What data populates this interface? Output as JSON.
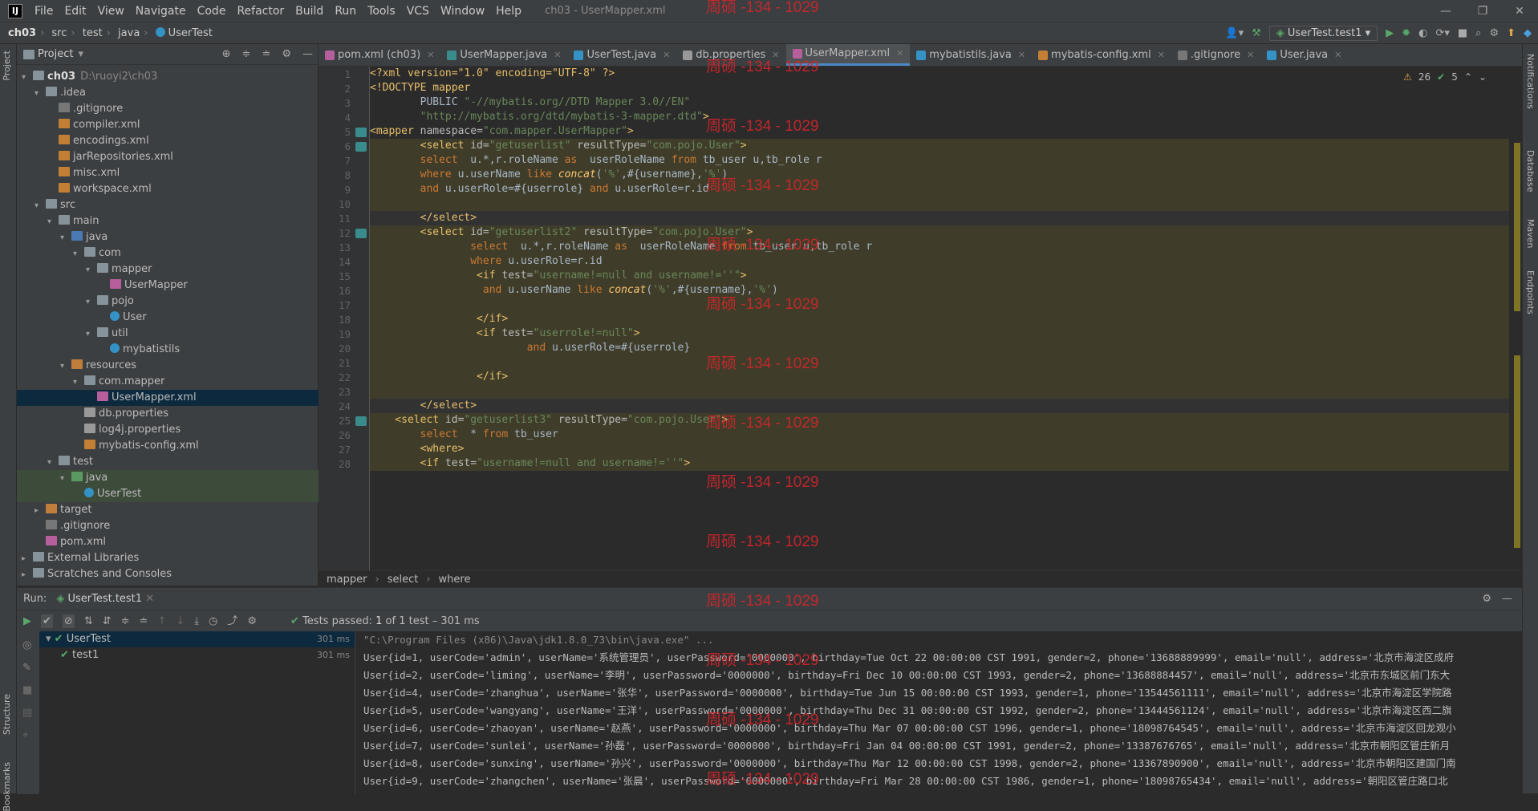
{
  "window": {
    "logo": "IJ",
    "menu": [
      "File",
      "Edit",
      "View",
      "Navigate",
      "Code",
      "Refactor",
      "Build",
      "Run",
      "Tools",
      "VCS",
      "Window",
      "Help"
    ],
    "title": "ch03 - UserMapper.xml",
    "buttons": [
      "—",
      "❐",
      "✕"
    ]
  },
  "nav": {
    "crumbs": [
      "ch03",
      "src",
      "test",
      "java",
      "UserTest"
    ],
    "run_config": "UserTest.test1"
  },
  "watermark": "周硕 -134 - 1029",
  "left_strip": {
    "project": "Project",
    "structure": "Structure",
    "bookmarks": "Bookmarks"
  },
  "right_strip": {
    "notifications": "Notifications",
    "database": "Database",
    "maven": "Maven",
    "endpoints": "Endpoints"
  },
  "project": {
    "title": "Project",
    "tree": [
      {
        "label": "ch03",
        "extra": "D:\\ruoyi2\\ch03",
        "depth": 0,
        "arrow": "v",
        "icon": "folder"
      },
      {
        "label": ".idea",
        "depth": 1,
        "arrow": "v",
        "icon": "folder"
      },
      {
        "label": ".gitignore",
        "depth": 2,
        "icon": "fileg"
      },
      {
        "label": "compiler.xml",
        "depth": 2,
        "icon": "filex"
      },
      {
        "label": "encodings.xml",
        "depth": 2,
        "icon": "filex"
      },
      {
        "label": "jarRepositories.xml",
        "depth": 2,
        "icon": "filex"
      },
      {
        "label": "misc.xml",
        "depth": 2,
        "icon": "filex"
      },
      {
        "label": "workspace.xml",
        "depth": 2,
        "icon": "filex"
      },
      {
        "label": "src",
        "depth": 1,
        "arrow": "v",
        "icon": "folder"
      },
      {
        "label": "main",
        "depth": 2,
        "arrow": "v",
        "icon": "folder"
      },
      {
        "label": "java",
        "depth": 3,
        "arrow": "v",
        "icon": "folder blue"
      },
      {
        "label": "com",
        "depth": 4,
        "arrow": "v",
        "icon": "folder"
      },
      {
        "label": "mapper",
        "depth": 5,
        "arrow": "v",
        "icon": "folder"
      },
      {
        "label": "UserMapper",
        "depth": 6,
        "icon": "filem"
      },
      {
        "label": "pojo",
        "depth": 5,
        "arrow": "v",
        "icon": "folder"
      },
      {
        "label": "User",
        "depth": 6,
        "icon": "filec"
      },
      {
        "label": "util",
        "depth": 5,
        "arrow": "v",
        "icon": "folder"
      },
      {
        "label": "mybatistils",
        "depth": 6,
        "icon": "filec"
      },
      {
        "label": "resources",
        "depth": 3,
        "arrow": "v",
        "icon": "folder orange"
      },
      {
        "label": "com.mapper",
        "depth": 4,
        "arrow": "v",
        "icon": "folder"
      },
      {
        "label": "UserMapper.xml",
        "depth": 5,
        "icon": "filem",
        "selected": true
      },
      {
        "label": "db.properties",
        "depth": 4,
        "icon": "filep"
      },
      {
        "label": "log4j.properties",
        "depth": 4,
        "icon": "filep"
      },
      {
        "label": "mybatis-config.xml",
        "depth": 4,
        "icon": "filex"
      },
      {
        "label": "test",
        "depth": 2,
        "arrow": "v",
        "icon": "folder"
      },
      {
        "label": "java",
        "depth": 3,
        "arrow": "v",
        "icon": "folder green",
        "highlight": true
      },
      {
        "label": "UserTest",
        "depth": 4,
        "icon": "filec",
        "highlight": true
      },
      {
        "label": "target",
        "depth": 1,
        "arrow": ">",
        "icon": "folder orange"
      },
      {
        "label": ".gitignore",
        "depth": 1,
        "icon": "fileg"
      },
      {
        "label": "pom.xml",
        "depth": 1,
        "icon": "filem"
      },
      {
        "label": "External Libraries",
        "depth": 0,
        "arrow": ">",
        "icon": "folder"
      },
      {
        "label": "Scratches and Consoles",
        "depth": 0,
        "arrow": ">",
        "icon": "folder"
      }
    ]
  },
  "tabs": [
    {
      "label": "pom.xml (ch03)",
      "color": "#b65f9c"
    },
    {
      "label": "UserMapper.java",
      "color": "#3a8c8c"
    },
    {
      "label": "UserTest.java",
      "color": "#3592c4"
    },
    {
      "label": "db.properties",
      "color": "#999999"
    },
    {
      "label": "UserMapper.xml",
      "color": "#b65f9c",
      "active": true
    },
    {
      "label": "mybatistils.java",
      "color": "#3592c4"
    },
    {
      "label": "mybatis-config.xml",
      "color": "#c27f35"
    },
    {
      "label": ".gitignore",
      "color": "#777777"
    },
    {
      "label": "User.java",
      "color": "#3592c4"
    }
  ],
  "inspection": {
    "warnings": "26",
    "ok": "5"
  },
  "code": [
    {
      "n": "1",
      "bg": "",
      "html": [
        [
          "t-pi",
          "<?xml version=\"1.0\" encoding=\"UTF-8\" ?>"
        ]
      ]
    },
    {
      "n": "2",
      "bg": "",
      "html": [
        [
          "t-pi",
          "<!DOCTYPE mapper"
        ]
      ]
    },
    {
      "n": "3",
      "bg": "",
      "html": [
        [
          "t-plain",
          "        PUBLIC "
        ],
        [
          "t-val",
          "\"-//mybatis.org//DTD Mapper 3.0//EN\""
        ]
      ]
    },
    {
      "n": "4",
      "bg": "",
      "html": [
        [
          "t-val",
          "        \"http://mybatis.org/dtd/mybatis-3-mapper.dtd\""
        ],
        [
          "t-pi",
          ">"
        ]
      ]
    },
    {
      "n": "5",
      "bg": "",
      "gicon": true,
      "html": [
        [
          "t-tag",
          "<mapper "
        ],
        [
          "t-attr",
          "namespace="
        ],
        [
          "t-val",
          "\"com.mapper.UserMapper\""
        ],
        [
          "t-tag",
          ">"
        ]
      ]
    },
    {
      "n": "6",
      "bg": "y",
      "gicon": true,
      "html": [
        [
          "t-tag",
          "        <select "
        ],
        [
          "t-attr",
          "id="
        ],
        [
          "t-val",
          "\"getuserlist\" "
        ],
        [
          "t-attr",
          "resultType="
        ],
        [
          "t-val",
          "\"com.pojo.User\""
        ],
        [
          "t-tag",
          ">"
        ]
      ]
    },
    {
      "n": "7",
      "bg": "y",
      "html": [
        [
          "t-kw",
          "        select  "
        ],
        [
          "t-plain",
          "u.*,r.roleName "
        ],
        [
          "t-kw",
          "as  "
        ],
        [
          "t-plain",
          "userRoleName "
        ],
        [
          "t-kw",
          "from "
        ],
        [
          "t-plain",
          "tb_user u,tb_role r"
        ]
      ]
    },
    {
      "n": "8",
      "bg": "y",
      "html": [
        [
          "t-kw",
          "        where "
        ],
        [
          "t-plain",
          "u.userName "
        ],
        [
          "t-kw",
          "like "
        ],
        [
          "t-fn",
          "concat"
        ],
        [
          "t-plain",
          "("
        ],
        [
          "t-str",
          "'%'"
        ],
        [
          "t-plain",
          ",#{username},"
        ],
        [
          "t-str",
          "'%'"
        ],
        [
          "t-plain",
          ")"
        ]
      ]
    },
    {
      "n": "9",
      "bg": "y",
      "html": [
        [
          "t-kw",
          "        and "
        ],
        [
          "t-plain",
          "u.userRole=#{userrole} "
        ],
        [
          "t-kw",
          "and "
        ],
        [
          "t-plain",
          "u.userRole=r.id"
        ]
      ]
    },
    {
      "n": "10",
      "bg": "y",
      "html": []
    },
    {
      "n": "11",
      "bg": "d",
      "html": [
        [
          "t-tag",
          "        </select>"
        ]
      ]
    },
    {
      "n": "12",
      "bg": "y",
      "gicon": true,
      "html": [
        [
          "t-tag",
          "        <select "
        ],
        [
          "t-attr",
          "id="
        ],
        [
          "t-val",
          "\"getuserlist2\" "
        ],
        [
          "t-attr",
          "resultType="
        ],
        [
          "t-val",
          "\"com.pojo.User\""
        ],
        [
          "t-tag",
          ">"
        ]
      ]
    },
    {
      "n": "13",
      "bg": "y",
      "html": [
        [
          "t-kw",
          "                select  "
        ],
        [
          "t-plain",
          "u.*,r.roleName "
        ],
        [
          "t-kw",
          "as  "
        ],
        [
          "t-plain",
          "userRoleName "
        ],
        [
          "t-kw",
          "from "
        ],
        [
          "t-plain",
          "tb_user u,tb_role r"
        ]
      ]
    },
    {
      "n": "14",
      "bg": "y",
      "html": [
        [
          "t-kw",
          "                where "
        ],
        [
          "t-plain",
          "u.userRole=r.id"
        ]
      ]
    },
    {
      "n": "15",
      "bg": "y",
      "html": [
        [
          "t-tag",
          "                 <if "
        ],
        [
          "t-attr",
          "test="
        ],
        [
          "t-val",
          "\"username!=null and username!=''\""
        ],
        [
          "t-tag",
          ">"
        ]
      ]
    },
    {
      "n": "16",
      "bg": "y",
      "html": [
        [
          "t-kw",
          "                  and "
        ],
        [
          "t-plain",
          "u.userName "
        ],
        [
          "t-kw",
          "like "
        ],
        [
          "t-fn",
          "concat"
        ],
        [
          "t-plain",
          "("
        ],
        [
          "t-str",
          "'%'"
        ],
        [
          "t-plain",
          ",#{username},"
        ],
        [
          "t-str",
          "'%'"
        ],
        [
          "t-plain",
          ")"
        ]
      ]
    },
    {
      "n": "17",
      "bg": "y",
      "html": []
    },
    {
      "n": "18",
      "bg": "y",
      "html": [
        [
          "t-tag",
          "                 </if>"
        ]
      ]
    },
    {
      "n": "19",
      "bg": "y",
      "html": [
        [
          "t-tag",
          "                 <if "
        ],
        [
          "t-attr",
          "test="
        ],
        [
          "t-val",
          "\"userrole!=null\""
        ],
        [
          "t-tag",
          ">"
        ]
      ]
    },
    {
      "n": "20",
      "bg": "y",
      "html": [
        [
          "t-kw",
          "                         and "
        ],
        [
          "t-plain",
          "u.userRole=#{userrole}"
        ]
      ]
    },
    {
      "n": "21",
      "bg": "y",
      "html": []
    },
    {
      "n": "22",
      "bg": "y",
      "html": [
        [
          "t-tag",
          "                 </if>"
        ]
      ]
    },
    {
      "n": "23",
      "bg": "y",
      "html": []
    },
    {
      "n": "24",
      "bg": "d",
      "html": [
        [
          "t-tag",
          "        </select>"
        ]
      ]
    },
    {
      "n": "25",
      "bg": "y",
      "gicon": true,
      "html": [
        [
          "t-tag",
          "    <select "
        ],
        [
          "t-attr",
          "id="
        ],
        [
          "t-val",
          "\"getuserlist3\" "
        ],
        [
          "t-attr",
          "resultType="
        ],
        [
          "t-val",
          "\"com.pojo.User\""
        ],
        [
          "t-tag",
          ">"
        ]
      ]
    },
    {
      "n": "26",
      "bg": "y",
      "html": [
        [
          "t-kw",
          "        select  "
        ],
        [
          "t-plain",
          "* "
        ],
        [
          "t-kw",
          "from "
        ],
        [
          "t-plain",
          "tb_user"
        ]
      ]
    },
    {
      "n": "27",
      "bg": "y",
      "html": [
        [
          "t-tag",
          "        <where>"
        ]
      ]
    },
    {
      "n": "28",
      "bg": "y",
      "html": [
        [
          "t-tag",
          "        <if "
        ],
        [
          "t-attr",
          "test="
        ],
        [
          "t-val",
          "\"username!=null and username!=''\""
        ],
        [
          "t-tag",
          ">"
        ]
      ]
    }
  ],
  "breadcrumb": [
    "mapper",
    "select",
    "where"
  ],
  "run": {
    "label": "Run:",
    "tab": "UserTest.test1",
    "status_prefix": "Tests passed:",
    "status_count": "1",
    "status_suffix": "of 1 test – 301 ms",
    "tests": [
      {
        "label": "UserTest",
        "time": "301 ms",
        "selected": true
      },
      {
        "label": "test1",
        "time": "301 ms"
      }
    ],
    "console": [
      "\"C:\\Program Files (x86)\\Java\\jdk1.8.0_73\\bin\\java.exe\" ...",
      "User{id=1, userCode='admin', userName='系统管理员', userPassword='0000000', birthday=Tue Oct 22 00:00:00 CST 1991, gender=2, phone='13688889999', email='null', address='北京市海淀区成府",
      "User{id=2, userCode='liming', userName='李明', userPassword='0000000', birthday=Fri Dec 10 00:00:00 CST 1993, gender=2, phone='13688884457', email='null', address='北京市东城区前门东大",
      "User{id=4, userCode='zhanghua', userName='张华', userPassword='0000000', birthday=Tue Jun 15 00:00:00 CST 1993, gender=1, phone='13544561111', email='null', address='北京市海淀区学院路",
      "User{id=5, userCode='wangyang', userName='王洋', userPassword='0000000', birthday=Thu Dec 31 00:00:00 CST 1992, gender=2, phone='13444561124', email='null', address='北京市海淀区西二旗",
      "User{id=6, userCode='zhaoyan', userName='赵燕', userPassword='0000000', birthday=Thu Mar 07 00:00:00 CST 1996, gender=1, phone='18098764545', email='null', address='北京市海淀区回龙观小",
      "User{id=7, userCode='sunlei', userName='孙磊', userPassword='0000000', birthday=Fri Jan 04 00:00:00 CST 1991, gender=2, phone='13387676765', email='null', address='北京市朝阳区管庄新月",
      "User{id=8, userCode='sunxing', userName='孙兴', userPassword='0000000', birthday=Thu Mar 12 00:00:00 CST 1998, gender=2, phone='13367890900', email='null', address='北京市朝阳区建国门南",
      "User{id=9, userCode='zhangchen', userName='张晨', userPassword='0000000', birthday=Fri Mar 28 00:00:00 CST 1986, gender=1, phone='18098765434', email='null', address='朝阳区管庄路口北"
    ]
  }
}
